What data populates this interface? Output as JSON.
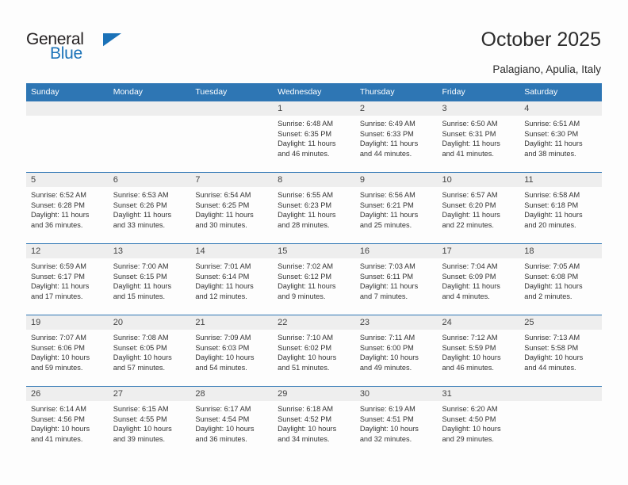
{
  "brand": {
    "name_top": "General",
    "name_bottom": "Blue",
    "accent_color": "#1b72b8",
    "logo_icon": "triangle-flag-icon"
  },
  "header": {
    "title": "October 2025",
    "location": "Palagiano, Apulia, Italy"
  },
  "theme": {
    "header_bg": "#2e76b4",
    "day_band_bg": "#eeeeee",
    "page_bg": "#fdfdfd",
    "text_color": "#333333"
  },
  "calendar": {
    "weekday_headers": [
      "Sunday",
      "Monday",
      "Tuesday",
      "Wednesday",
      "Thursday",
      "Friday",
      "Saturday"
    ],
    "weeks": [
      [
        {
          "day": "",
          "sunrise": "",
          "sunset": "",
          "daylight_line1": "",
          "daylight_line2": ""
        },
        {
          "day": "",
          "sunrise": "",
          "sunset": "",
          "daylight_line1": "",
          "daylight_line2": ""
        },
        {
          "day": "",
          "sunrise": "",
          "sunset": "",
          "daylight_line1": "",
          "daylight_line2": ""
        },
        {
          "day": "1",
          "sunrise": "Sunrise: 6:48 AM",
          "sunset": "Sunset: 6:35 PM",
          "daylight_line1": "Daylight: 11 hours",
          "daylight_line2": "and 46 minutes."
        },
        {
          "day": "2",
          "sunrise": "Sunrise: 6:49 AM",
          "sunset": "Sunset: 6:33 PM",
          "daylight_line1": "Daylight: 11 hours",
          "daylight_line2": "and 44 minutes."
        },
        {
          "day": "3",
          "sunrise": "Sunrise: 6:50 AM",
          "sunset": "Sunset: 6:31 PM",
          "daylight_line1": "Daylight: 11 hours",
          "daylight_line2": "and 41 minutes."
        },
        {
          "day": "4",
          "sunrise": "Sunrise: 6:51 AM",
          "sunset": "Sunset: 6:30 PM",
          "daylight_line1": "Daylight: 11 hours",
          "daylight_line2": "and 38 minutes."
        }
      ],
      [
        {
          "day": "5",
          "sunrise": "Sunrise: 6:52 AM",
          "sunset": "Sunset: 6:28 PM",
          "daylight_line1": "Daylight: 11 hours",
          "daylight_line2": "and 36 minutes."
        },
        {
          "day": "6",
          "sunrise": "Sunrise: 6:53 AM",
          "sunset": "Sunset: 6:26 PM",
          "daylight_line1": "Daylight: 11 hours",
          "daylight_line2": "and 33 minutes."
        },
        {
          "day": "7",
          "sunrise": "Sunrise: 6:54 AM",
          "sunset": "Sunset: 6:25 PM",
          "daylight_line1": "Daylight: 11 hours",
          "daylight_line2": "and 30 minutes."
        },
        {
          "day": "8",
          "sunrise": "Sunrise: 6:55 AM",
          "sunset": "Sunset: 6:23 PM",
          "daylight_line1": "Daylight: 11 hours",
          "daylight_line2": "and 28 minutes."
        },
        {
          "day": "9",
          "sunrise": "Sunrise: 6:56 AM",
          "sunset": "Sunset: 6:21 PM",
          "daylight_line1": "Daylight: 11 hours",
          "daylight_line2": "and 25 minutes."
        },
        {
          "day": "10",
          "sunrise": "Sunrise: 6:57 AM",
          "sunset": "Sunset: 6:20 PM",
          "daylight_line1": "Daylight: 11 hours",
          "daylight_line2": "and 22 minutes."
        },
        {
          "day": "11",
          "sunrise": "Sunrise: 6:58 AM",
          "sunset": "Sunset: 6:18 PM",
          "daylight_line1": "Daylight: 11 hours",
          "daylight_line2": "and 20 minutes."
        }
      ],
      [
        {
          "day": "12",
          "sunrise": "Sunrise: 6:59 AM",
          "sunset": "Sunset: 6:17 PM",
          "daylight_line1": "Daylight: 11 hours",
          "daylight_line2": "and 17 minutes."
        },
        {
          "day": "13",
          "sunrise": "Sunrise: 7:00 AM",
          "sunset": "Sunset: 6:15 PM",
          "daylight_line1": "Daylight: 11 hours",
          "daylight_line2": "and 15 minutes."
        },
        {
          "day": "14",
          "sunrise": "Sunrise: 7:01 AM",
          "sunset": "Sunset: 6:14 PM",
          "daylight_line1": "Daylight: 11 hours",
          "daylight_line2": "and 12 minutes."
        },
        {
          "day": "15",
          "sunrise": "Sunrise: 7:02 AM",
          "sunset": "Sunset: 6:12 PM",
          "daylight_line1": "Daylight: 11 hours",
          "daylight_line2": "and 9 minutes."
        },
        {
          "day": "16",
          "sunrise": "Sunrise: 7:03 AM",
          "sunset": "Sunset: 6:11 PM",
          "daylight_line1": "Daylight: 11 hours",
          "daylight_line2": "and 7 minutes."
        },
        {
          "day": "17",
          "sunrise": "Sunrise: 7:04 AM",
          "sunset": "Sunset: 6:09 PM",
          "daylight_line1": "Daylight: 11 hours",
          "daylight_line2": "and 4 minutes."
        },
        {
          "day": "18",
          "sunrise": "Sunrise: 7:05 AM",
          "sunset": "Sunset: 6:08 PM",
          "daylight_line1": "Daylight: 11 hours",
          "daylight_line2": "and 2 minutes."
        }
      ],
      [
        {
          "day": "19",
          "sunrise": "Sunrise: 7:07 AM",
          "sunset": "Sunset: 6:06 PM",
          "daylight_line1": "Daylight: 10 hours",
          "daylight_line2": "and 59 minutes."
        },
        {
          "day": "20",
          "sunrise": "Sunrise: 7:08 AM",
          "sunset": "Sunset: 6:05 PM",
          "daylight_line1": "Daylight: 10 hours",
          "daylight_line2": "and 57 minutes."
        },
        {
          "day": "21",
          "sunrise": "Sunrise: 7:09 AM",
          "sunset": "Sunset: 6:03 PM",
          "daylight_line1": "Daylight: 10 hours",
          "daylight_line2": "and 54 minutes."
        },
        {
          "day": "22",
          "sunrise": "Sunrise: 7:10 AM",
          "sunset": "Sunset: 6:02 PM",
          "daylight_line1": "Daylight: 10 hours",
          "daylight_line2": "and 51 minutes."
        },
        {
          "day": "23",
          "sunrise": "Sunrise: 7:11 AM",
          "sunset": "Sunset: 6:00 PM",
          "daylight_line1": "Daylight: 10 hours",
          "daylight_line2": "and 49 minutes."
        },
        {
          "day": "24",
          "sunrise": "Sunrise: 7:12 AM",
          "sunset": "Sunset: 5:59 PM",
          "daylight_line1": "Daylight: 10 hours",
          "daylight_line2": "and 46 minutes."
        },
        {
          "day": "25",
          "sunrise": "Sunrise: 7:13 AM",
          "sunset": "Sunset: 5:58 PM",
          "daylight_line1": "Daylight: 10 hours",
          "daylight_line2": "and 44 minutes."
        }
      ],
      [
        {
          "day": "26",
          "sunrise": "Sunrise: 6:14 AM",
          "sunset": "Sunset: 4:56 PM",
          "daylight_line1": "Daylight: 10 hours",
          "daylight_line2": "and 41 minutes."
        },
        {
          "day": "27",
          "sunrise": "Sunrise: 6:15 AM",
          "sunset": "Sunset: 4:55 PM",
          "daylight_line1": "Daylight: 10 hours",
          "daylight_line2": "and 39 minutes."
        },
        {
          "day": "28",
          "sunrise": "Sunrise: 6:17 AM",
          "sunset": "Sunset: 4:54 PM",
          "daylight_line1": "Daylight: 10 hours",
          "daylight_line2": "and 36 minutes."
        },
        {
          "day": "29",
          "sunrise": "Sunrise: 6:18 AM",
          "sunset": "Sunset: 4:52 PM",
          "daylight_line1": "Daylight: 10 hours",
          "daylight_line2": "and 34 minutes."
        },
        {
          "day": "30",
          "sunrise": "Sunrise: 6:19 AM",
          "sunset": "Sunset: 4:51 PM",
          "daylight_line1": "Daylight: 10 hours",
          "daylight_line2": "and 32 minutes."
        },
        {
          "day": "31",
          "sunrise": "Sunrise: 6:20 AM",
          "sunset": "Sunset: 4:50 PM",
          "daylight_line1": "Daylight: 10 hours",
          "daylight_line2": "and 29 minutes."
        },
        {
          "day": "",
          "sunrise": "",
          "sunset": "",
          "daylight_line1": "",
          "daylight_line2": ""
        }
      ]
    ]
  }
}
